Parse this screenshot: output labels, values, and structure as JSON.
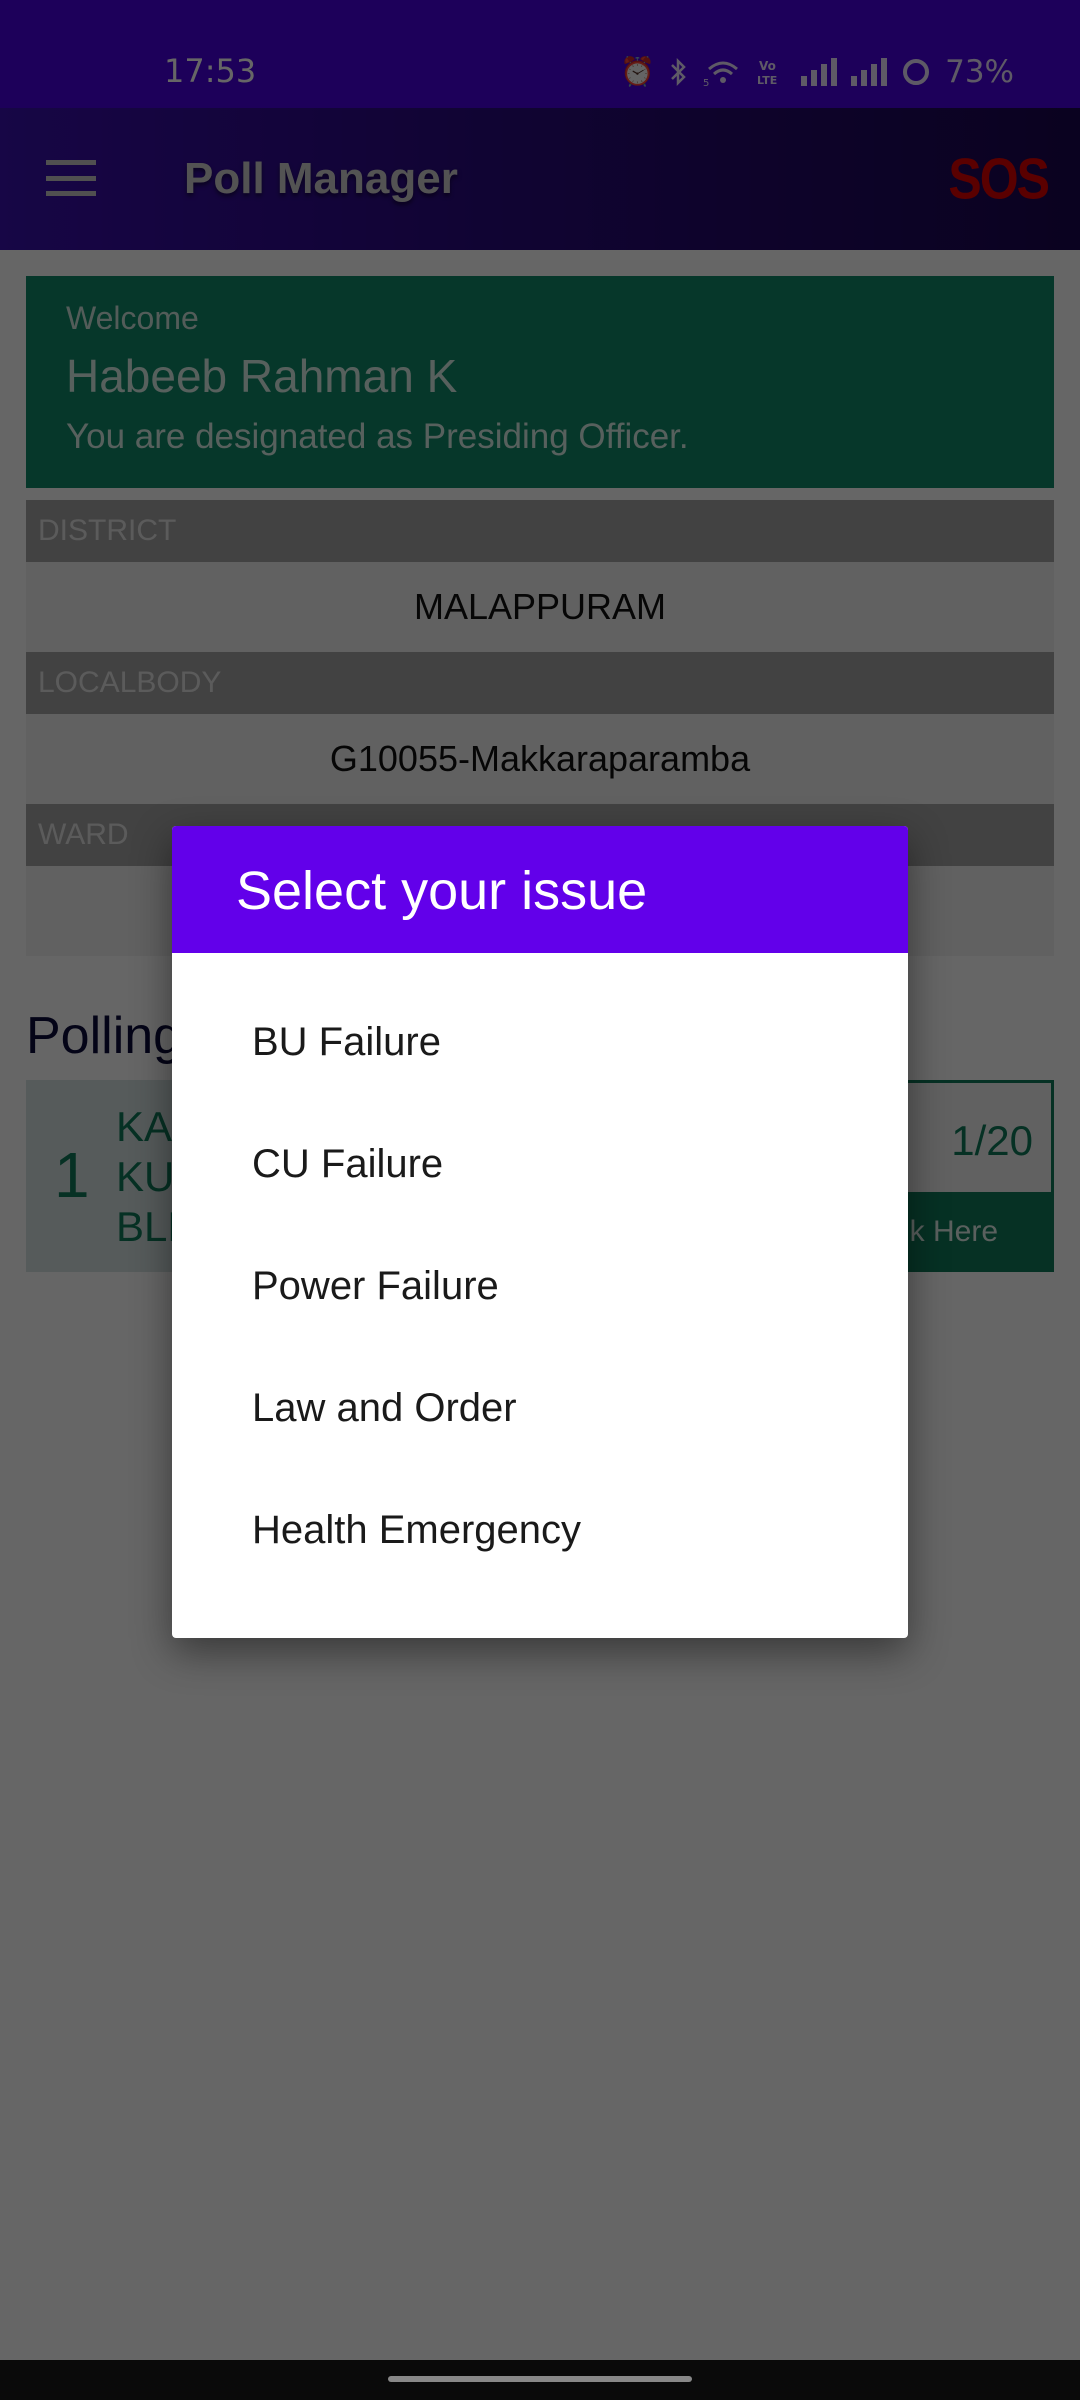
{
  "status_bar": {
    "time": "17:53",
    "icons": [
      "alarm-icon",
      "bluetooth-icon",
      "wifi-5g-icon",
      "volte-icon",
      "signal-icon",
      "signal-icon",
      "battery-icon"
    ],
    "battery_percent": "73%"
  },
  "app_bar": {
    "title": "Poll Manager",
    "menu_icon": "hamburger-icon",
    "sos_label": "SOS"
  },
  "welcome": {
    "greeting": "Welcome",
    "name": "Habeeb Rahman K",
    "designation": "You are designated as Presiding Officer."
  },
  "fields": [
    {
      "label": "DISTRICT",
      "value": "MALAPPURAM"
    },
    {
      "label": "LOCALBODY",
      "value": "G10055-Makkaraparamba"
    },
    {
      "label": "WARD",
      "value": ""
    }
  ],
  "polling": {
    "title": "Polling",
    "station": {
      "number": "1",
      "name_lines": [
        "KA",
        "KU",
        "BLD"
      ],
      "count": "1/20",
      "action_label": "k  Here"
    }
  },
  "dialog": {
    "title": "Select your issue",
    "options": [
      {
        "label": "BU Failure"
      },
      {
        "label": "CU Failure"
      },
      {
        "label": "Power Failure"
      },
      {
        "label": "Law and Order"
      },
      {
        "label": "Health Emergency"
      }
    ]
  },
  "colors": {
    "status_bar": "#4a00e0",
    "dialog_header": "#6200ea",
    "welcome_bg": "#0f8a6a",
    "sos": "#e00000"
  }
}
